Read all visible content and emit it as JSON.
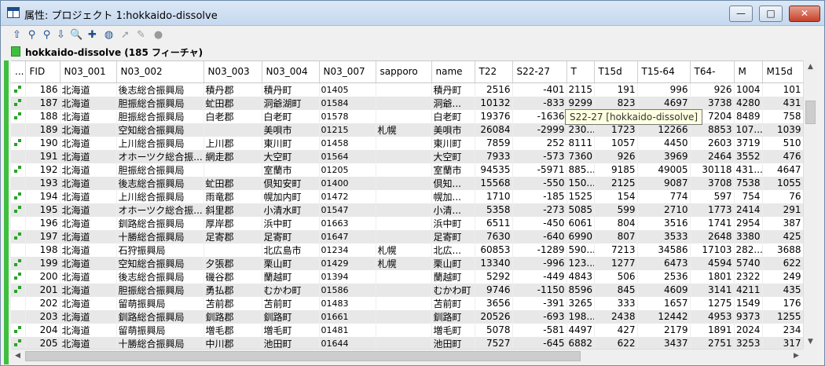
{
  "window": {
    "title": "属性: プロジェクト 1:hokkaido-dissolve",
    "min_symbol": "—",
    "max_symbol": "□",
    "close_symbol": "✕"
  },
  "toolbar": {
    "icons": [
      "up-arrow-icon",
      "zoom-layer-icon",
      "zoom-select-icon",
      "down-arrow-icon",
      "magnifier-icon",
      "pan-icon",
      "globe-icon",
      "pointer-icon",
      "pencil-icon",
      "circle-icon"
    ],
    "glyphs": [
      "⇧",
      "⚲",
      "⚲",
      "⇩",
      "🔍",
      "✚",
      "◍",
      "➚",
      "✎",
      "●"
    ]
  },
  "layer": {
    "name": "hokkaido-dissolve (185 フィーチャ)",
    "color": "#3fbf3f"
  },
  "table": {
    "headers": [
      "...",
      "FID",
      "N03_001",
      "N03_002",
      "N03_003",
      "N03_004",
      "N03_007",
      "sapporo",
      "name",
      "T22",
      "S22-27",
      "T",
      "T15d",
      "T15-64",
      "T64-",
      "M",
      "M15d"
    ],
    "rows": [
      [
        "186",
        "北海道",
        "後志総合振興局",
        "積丹郡",
        "積丹町",
        "01405",
        "",
        "積丹町",
        "2516",
        "-401",
        "2115",
        "191",
        "996",
        "926",
        "1004",
        "101"
      ],
      [
        "187",
        "北海道",
        "胆振総合振興局",
        "虻田郡",
        "洞爺湖町",
        "01584",
        "",
        "洞爺...",
        "10132",
        "-833",
        "9299",
        "823",
        "4697",
        "3738",
        "4280",
        "431"
      ],
      [
        "188",
        "北海道",
        "胆振総合振興局",
        "白老郡",
        "白老町",
        "01578",
        "",
        "白老町",
        "19376",
        "-1636",
        "",
        "",
        "",
        "7204",
        "8489",
        "758"
      ],
      [
        "189",
        "北海道",
        "空知総合振興局",
        "",
        "美唄市",
        "01215",
        "札幌",
        "美唄市",
        "26084",
        "-2999",
        "230...",
        "1723",
        "12266",
        "8853",
        "107...",
        "1039"
      ],
      [
        "190",
        "北海道",
        "上川総合振興局",
        "上川郡",
        "東川町",
        "01458",
        "",
        "東川町",
        "7859",
        "252",
        "8111",
        "1057",
        "4450",
        "2603",
        "3719",
        "510"
      ],
      [
        "191",
        "北海道",
        "オホーツク総合振...",
        "網走郡",
        "大空町",
        "01564",
        "",
        "大空町",
        "7933",
        "-573",
        "7360",
        "926",
        "3969",
        "2464",
        "3552",
        "476"
      ],
      [
        "192",
        "北海道",
        "胆振総合振興局",
        "",
        "室蘭市",
        "01205",
        "",
        "室蘭市",
        "94535",
        "-5971",
        "885...",
        "9185",
        "49005",
        "30118",
        "431...",
        "4647"
      ],
      [
        "193",
        "北海道",
        "後志総合振興局",
        "虻田郡",
        "倶知安町",
        "01400",
        "",
        "倶知...",
        "15568",
        "-550",
        "150...",
        "2125",
        "9087",
        "3708",
        "7538",
        "1055"
      ],
      [
        "194",
        "北海道",
        "上川総合振興局",
        "雨竜郡",
        "幌加内町",
        "01472",
        "",
        "幌加...",
        "1710",
        "-185",
        "1525",
        "154",
        "774",
        "597",
        "754",
        "76"
      ],
      [
        "195",
        "北海道",
        "オホーツク総合振...",
        "斜里郡",
        "小清水町",
        "01547",
        "",
        "小清...",
        "5358",
        "-273",
        "5085",
        "599",
        "2710",
        "1773",
        "2414",
        "291"
      ],
      [
        "196",
        "北海道",
        "釧路総合振興局",
        "厚岸郡",
        "浜中町",
        "01663",
        "",
        "浜中町",
        "6511",
        "-450",
        "6061",
        "804",
        "3516",
        "1741",
        "2954",
        "387"
      ],
      [
        "197",
        "北海道",
        "十勝総合振興局",
        "足寄郡",
        "足寄町",
        "01647",
        "",
        "足寄町",
        "7630",
        "-640",
        "6990",
        "807",
        "3533",
        "2648",
        "3380",
        "425"
      ],
      [
        "198",
        "北海道",
        "石狩振興局",
        "",
        "北広島市",
        "01234",
        "札幌",
        "北広...",
        "60853",
        "-1289",
        "590...",
        "7213",
        "34586",
        "17103",
        "282...",
        "3688"
      ],
      [
        "199",
        "北海道",
        "空知総合振興局",
        "夕張郡",
        "栗山町",
        "01429",
        "札幌",
        "栗山町",
        "13340",
        "-996",
        "123...",
        "1277",
        "6473",
        "4594",
        "5740",
        "622"
      ],
      [
        "200",
        "北海道",
        "後志総合振興局",
        "磯谷郡",
        "蘭越町",
        "01394",
        "",
        "蘭越町",
        "5292",
        "-449",
        "4843",
        "506",
        "2536",
        "1801",
        "2322",
        "249"
      ],
      [
        "201",
        "北海道",
        "胆振総合振興局",
        "勇払郡",
        "むかわ町",
        "01586",
        "",
        "むかわ町",
        "9746",
        "-1150",
        "8596",
        "845",
        "4609",
        "3141",
        "4211",
        "435"
      ],
      [
        "202",
        "北海道",
        "留萌振興局",
        "苫前郡",
        "苫前町",
        "01483",
        "",
        "苫前町",
        "3656",
        "-391",
        "3265",
        "333",
        "1657",
        "1275",
        "1549",
        "176"
      ],
      [
        "203",
        "北海道",
        "釧路総合振興局",
        "釧路郡",
        "釧路町",
        "01661",
        "",
        "釧路町",
        "20526",
        "-693",
        "198...",
        "2438",
        "12442",
        "4953",
        "9373",
        "1255"
      ],
      [
        "204",
        "北海道",
        "留萌振興局",
        "増毛郡",
        "増毛町",
        "01481",
        "",
        "増毛町",
        "5078",
        "-581",
        "4497",
        "427",
        "2179",
        "1891",
        "2024",
        "234"
      ],
      [
        "205",
        "北海道",
        "十勝総合振興局",
        "中川郡",
        "池田町",
        "01644",
        "",
        "池田町",
        "7527",
        "-645",
        "6882",
        "622",
        "3437",
        "2751",
        "3253",
        "317"
      ],
      [
        "206",
        "北海道",
        "後志総合振興局",
        "虻田郡",
        "喜茂別町",
        "01398",
        "",
        "喜茂...",
        "2490",
        "-196",
        "2294",
        "207",
        "1204",
        "866",
        "1171",
        "109"
      ]
    ],
    "marked_rows": [
      0,
      1,
      2,
      4,
      6,
      8,
      9,
      11,
      13,
      14,
      15,
      18,
      19
    ],
    "alt_rows": [
      1,
      3,
      5,
      7,
      9,
      11,
      13,
      15,
      17,
      19
    ]
  },
  "tooltip": {
    "text": "S22-27 [hokkaido-dissolve]"
  },
  "scrollbars": {
    "up": "▲",
    "down": "▼",
    "left": "◀",
    "right": "▶"
  }
}
